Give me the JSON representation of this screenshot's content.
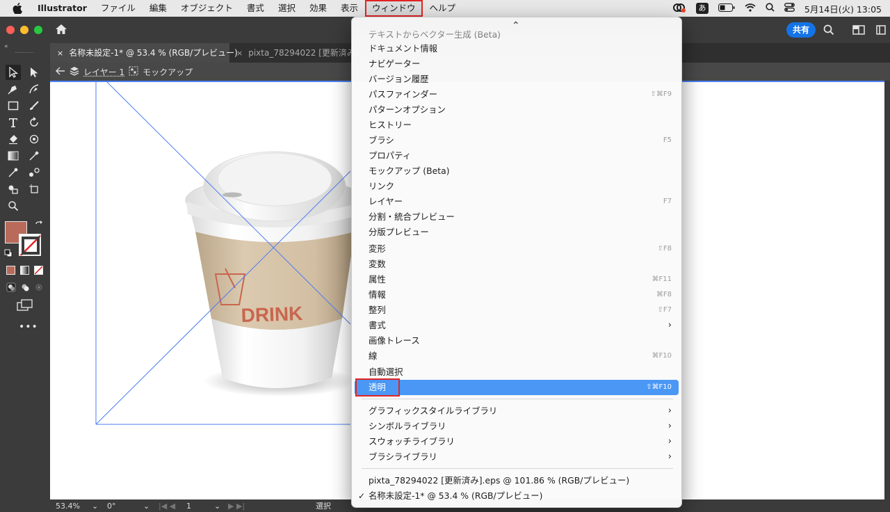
{
  "menubar": {
    "app_name": "Illustrator",
    "items": [
      "ファイル",
      "編集",
      "オブジェクト",
      "書式",
      "選択",
      "効果",
      "表示",
      "ウィンドウ",
      "ヘルプ"
    ],
    "active_index": 7,
    "ime": "あ",
    "clock": "5月14日(火) 13:05"
  },
  "appbar": {
    "share_label": "共有"
  },
  "tabs": [
    {
      "label": "名称未設定-1* @ 53.4 % (RGB/プレビュー)",
      "close": "×"
    },
    {
      "label": "pixta_78294022 [更新済み]",
      "close": "×"
    }
  ],
  "breadcrumb": {
    "layer": "レイヤー 1",
    "group": "モックアップ"
  },
  "artwork": {
    "logo_text": "DRINK"
  },
  "status": {
    "zoom": "53.4%",
    "rotation": "0°",
    "artboard": "1",
    "tool": "選択"
  },
  "colors": {
    "fill": "#b96a5a",
    "accent": "#4a97f5",
    "highlight_box": "#e02424"
  },
  "window_menu": {
    "scroll_indicator": "⌃",
    "items": [
      {
        "label": "テキストからベクター生成 (Beta)",
        "shortcut": ""
      },
      {
        "label": "ドキュメント情報",
        "shortcut": ""
      },
      {
        "label": "ナビゲーター",
        "shortcut": ""
      },
      {
        "label": "バージョン履歴",
        "shortcut": ""
      },
      {
        "label": "パスファインダー",
        "shortcut": "⇧⌘F9"
      },
      {
        "label": "パターンオプション",
        "shortcut": ""
      },
      {
        "label": "ヒストリー",
        "shortcut": ""
      },
      {
        "label": "ブラシ",
        "shortcut": "F5"
      },
      {
        "label": "プロパティ",
        "shortcut": ""
      },
      {
        "label": "モックアップ (Beta)",
        "shortcut": ""
      },
      {
        "label": "リンク",
        "shortcut": ""
      },
      {
        "label": "レイヤー",
        "shortcut": "F7"
      },
      {
        "label": "分割・統合プレビュー",
        "shortcut": ""
      },
      {
        "label": "分版プレビュー",
        "shortcut": ""
      },
      {
        "label": "変形",
        "shortcut": "⇧F8"
      },
      {
        "label": "変数",
        "shortcut": ""
      },
      {
        "label": "属性",
        "shortcut": "⌘F11"
      },
      {
        "label": "情報",
        "shortcut": "⌘F8"
      },
      {
        "label": "整列",
        "shortcut": "⇧F7"
      },
      {
        "label": "書式",
        "shortcut": "",
        "submenu": true
      },
      {
        "label": "画像トレース",
        "shortcut": ""
      },
      {
        "label": "線",
        "shortcut": "⌘F10"
      },
      {
        "label": "自動選択",
        "shortcut": ""
      },
      {
        "label": "透明",
        "shortcut": "⇧⌘F10",
        "highlighted": true
      }
    ],
    "libraries": [
      {
        "label": "グラフィックスタイルライブラリ",
        "submenu": true
      },
      {
        "label": "シンボルライブラリ",
        "submenu": true
      },
      {
        "label": "スウォッチライブラリ",
        "submenu": true
      },
      {
        "label": "ブラシライブラリ",
        "submenu": true
      }
    ],
    "documents": [
      {
        "label": "pixta_78294022 [更新済み].eps @ 101.86 % (RGB/プレビュー)",
        "checked": false
      },
      {
        "label": "名称未設定-1* @ 53.4 % (RGB/プレビュー)",
        "checked": true
      }
    ],
    "check_mark": "✓",
    "submenu_arrow": "›"
  }
}
